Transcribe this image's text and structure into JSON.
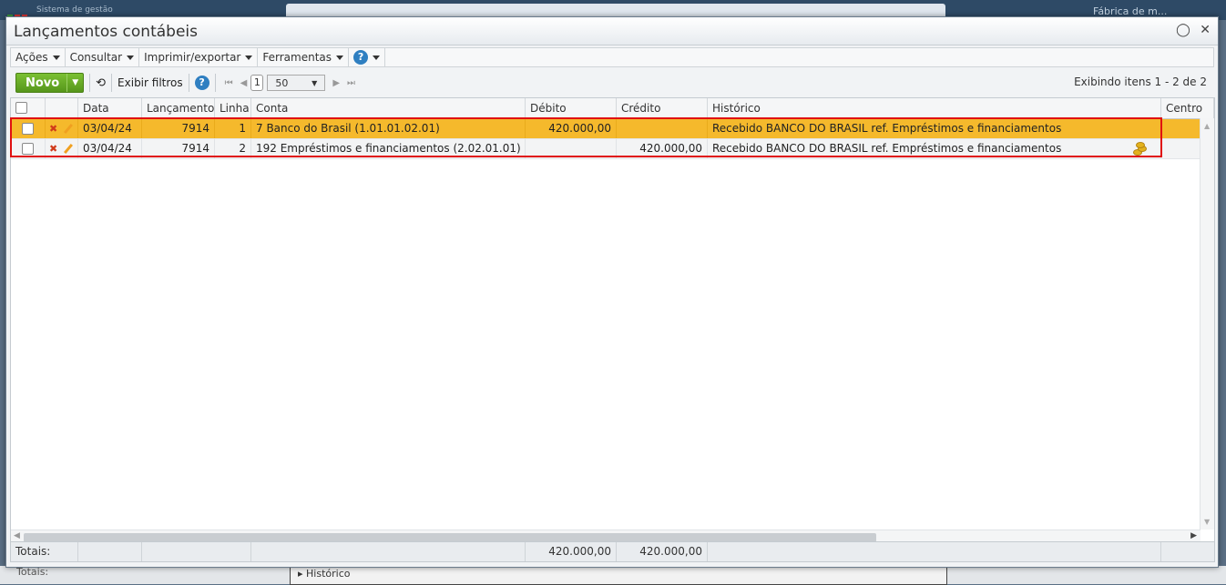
{
  "background": {
    "app_title": "Sistema de gestão",
    "company": "Fábrica de m...",
    "totals_label": "Totais:",
    "history_label": "Histórico"
  },
  "window": {
    "title": "Lançamentos contábeis",
    "chat_icon": "chat-bubble-icon",
    "close_icon": "close-icon"
  },
  "menubar": {
    "items": [
      "Ações",
      "Consultar",
      "Imprimir/exportar",
      "Ferramentas"
    ],
    "help": "?"
  },
  "toolbar": {
    "new_label": "Novo",
    "show_filters": "Exibir filtros",
    "page": "1",
    "page_size": "50",
    "showing": "Exibindo itens 1 - 2 de 2"
  },
  "grid": {
    "columns": [
      "Data",
      "Lançamento",
      "Linha",
      "Conta",
      "Débito",
      "Crédito",
      "Histórico",
      "Centro"
    ],
    "rows": [
      {
        "data": "03/04/24",
        "lancamento": "7914",
        "linha": "1",
        "conta": "7 Banco do Brasil (1.01.01.02.01)",
        "debito": "420.000,00",
        "credito": "",
        "historico": "Recebido BANCO DO BRASIL ref. Empréstimos e financiamentos"
      },
      {
        "data": "03/04/24",
        "lancamento": "7914",
        "linha": "2",
        "conta": "192 Empréstimos e financiamentos (2.02.01.01)",
        "debito": "",
        "credito": "420.000,00",
        "historico": "Recebido BANCO DO BRASIL ref. Empréstimos e financiamentos"
      }
    ]
  },
  "totals": {
    "label": "Totais:",
    "debito": "420.000,00",
    "credito": "420.000,00"
  },
  "colors": {
    "selected_row": "#f5b92c",
    "highlight_border": "#e01010",
    "new_button": "#6aaa27"
  }
}
